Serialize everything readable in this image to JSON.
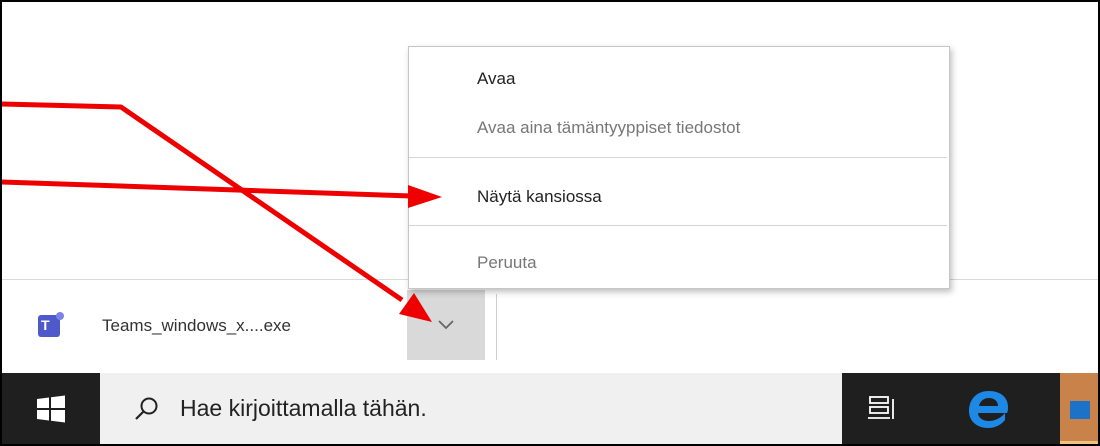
{
  "menu": {
    "items": [
      {
        "label": "Avaa",
        "disabled": false
      },
      {
        "label": "Avaa aina tämäntyyppiset tiedostot",
        "disabled": true
      },
      {
        "label": "Näytä kansiossa",
        "disabled": false
      },
      {
        "label": "Peruuta",
        "disabled": true
      }
    ]
  },
  "download": {
    "filename": "Teams_windows_x....exe",
    "icon": "teams-icon"
  },
  "taskbar": {
    "search_placeholder": "Hae kirjoittamalla tähän.",
    "icons": [
      "windows-start-icon",
      "search-icon",
      "task-view-icon",
      "edge-icon",
      "app-icon"
    ]
  },
  "colors": {
    "annotation_arrow": "#ee0000",
    "taskbar_bg": "#1f1f1f",
    "search_bg": "#f0f0f0",
    "teams_purple": "#5059c9",
    "edge_blue": "#1e88e5"
  }
}
